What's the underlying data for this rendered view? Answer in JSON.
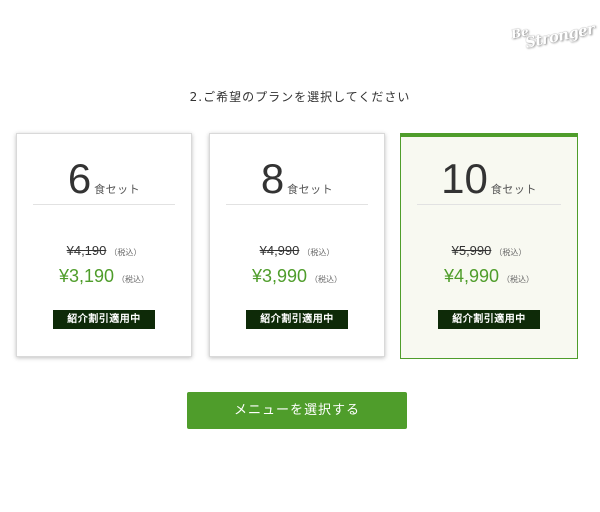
{
  "logo": {
    "line1": "Be",
    "line2": "Stronger"
  },
  "heading": "2.ご希望のプランを選択してください",
  "plans": [
    {
      "count": "6",
      "unit": "食セット",
      "old_price": "¥4,190",
      "old_tax": "（税込）",
      "new_price": "¥3,190",
      "new_tax": "（税込）",
      "badge": "紹介割引適用中",
      "selected": false
    },
    {
      "count": "8",
      "unit": "食セット",
      "old_price": "¥4,990",
      "old_tax": "（税込）",
      "new_price": "¥3,990",
      "new_tax": "（税込）",
      "badge": "紹介割引適用中",
      "selected": false
    },
    {
      "count": "10",
      "unit": "食セット",
      "old_price": "¥5,990",
      "old_tax": "（税込）",
      "new_price": "¥4,990",
      "new_tax": "（税込）",
      "badge": "紹介割引適用中",
      "selected": true
    }
  ],
  "select_button_label": "メニューを選択する",
  "colors": {
    "accent_green": "#4f9d2b",
    "badge_background": "#0e2a08",
    "selected_card_background": "#f8f9f1"
  }
}
